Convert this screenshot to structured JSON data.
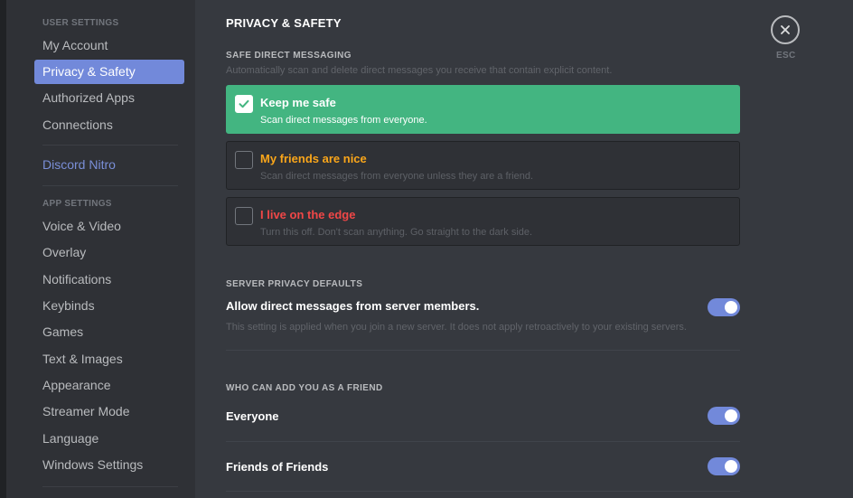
{
  "sidebar": {
    "user_settings_header": "USER SETTINGS",
    "user_items": [
      "My Account",
      "Privacy & Safety",
      "Authorized Apps",
      "Connections"
    ],
    "nitro": "Discord Nitro",
    "app_settings_header": "APP SETTINGS",
    "app_items": [
      "Voice & Video",
      "Overlay",
      "Notifications",
      "Keybinds",
      "Games",
      "Text & Images",
      "Appearance",
      "Streamer Mode",
      "Language",
      "Windows Settings"
    ],
    "active_item": "Privacy & Safety"
  },
  "main": {
    "title": "PRIVACY & SAFETY",
    "safe_dm": {
      "label": "SAFE DIRECT MESSAGING",
      "description": "Automatically scan and delete direct messages you receive that contain explicit content.",
      "options": [
        {
          "title": "Keep me safe",
          "desc": "Scan direct messages from everyone.",
          "selected": true
        },
        {
          "title": "My friends are nice",
          "desc": "Scan direct messages from everyone unless they are a friend.",
          "selected": false
        },
        {
          "title": "I live on the edge",
          "desc": "Turn this off. Don't scan anything. Go straight to the dark side.",
          "selected": false
        }
      ]
    },
    "server_privacy": {
      "label": "SERVER PRIVACY DEFAULTS",
      "title": "Allow direct messages from server members.",
      "desc": "This setting is applied when you join a new server. It does not apply retroactively to your existing servers.",
      "enabled": true
    },
    "add_friend": {
      "label": "WHO CAN ADD YOU AS A FRIEND",
      "rows": [
        {
          "title": "Everyone",
          "enabled": true
        },
        {
          "title": "Friends of Friends",
          "enabled": true
        }
      ]
    }
  },
  "close": {
    "esc_label": "ESC",
    "icon": "close-icon"
  },
  "colors": {
    "accent": "#7289da",
    "green": "#43b581",
    "orange": "#faa61a",
    "red": "#f04747"
  }
}
